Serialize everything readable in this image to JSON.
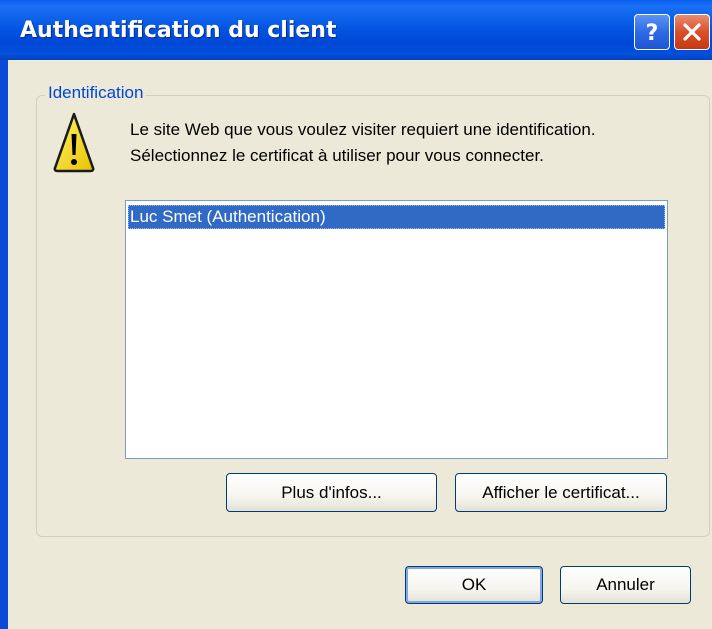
{
  "window": {
    "title": "Authentification du client"
  },
  "titlebar_buttons": {
    "help_icon": "help-icon",
    "close_icon": "close-icon"
  },
  "group": {
    "legend": "Identification",
    "warning_icon": "warning-icon",
    "message_line1": "Le site Web que vous voulez visiter requiert une identification.",
    "message_line2": "Sélectionnez le certificat à utiliser pour vous connecter."
  },
  "certificates": {
    "items": [
      "Luc Smet (Authentication)"
    ],
    "selected_index": 0
  },
  "buttons": {
    "more_info": "Plus d'infos...",
    "view_certificate": "Afficher le certificat...",
    "ok": "OK",
    "cancel": "Annuler"
  },
  "colors": {
    "titlebar": "#0054e3",
    "dialog_bg": "#ece9d8",
    "selection": "#316ac5",
    "legend_text": "#0046d5"
  }
}
